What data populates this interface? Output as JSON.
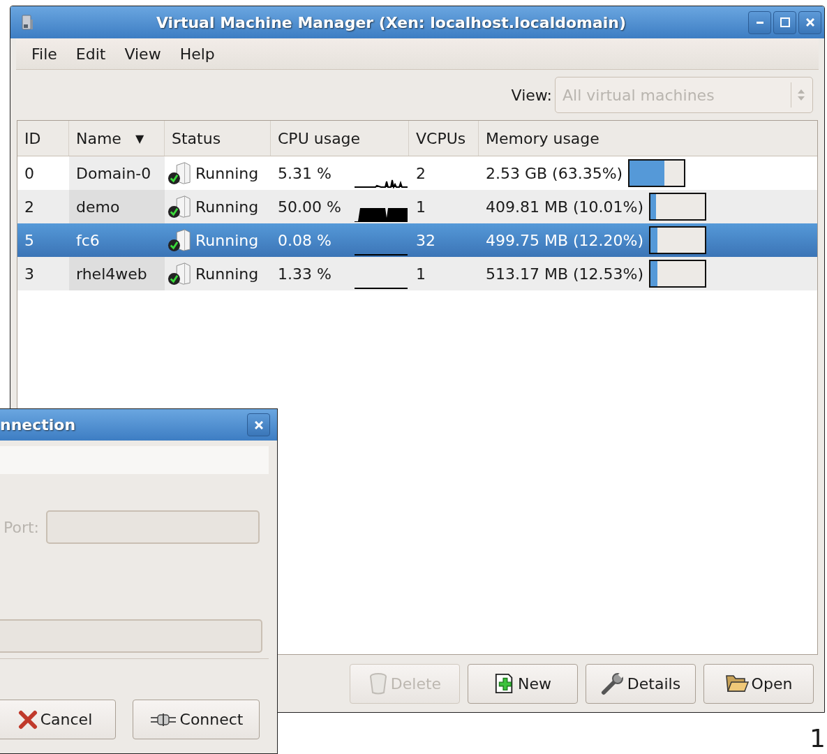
{
  "window": {
    "title": "Virtual Machine Manager (Xen: localhost.localdomain)"
  },
  "menu": [
    "File",
    "Edit",
    "View",
    "Help"
  ],
  "view_filter": {
    "label": "View:",
    "value": "All virtual machines",
    "disabled": true
  },
  "table": {
    "columns": [
      {
        "label": "ID"
      },
      {
        "label": "Name",
        "sort_arrow": "▼"
      },
      {
        "label": "Status"
      },
      {
        "label": "CPU usage"
      },
      {
        "label": "VCPUs"
      },
      {
        "label": "Memory usage"
      }
    ],
    "rows": [
      {
        "id": "0",
        "name": "Domain-0",
        "status": "Running",
        "cpu": "5.31 %",
        "vcpus": "2",
        "memory": "2.53 GB (63.35%)",
        "level": 0.6335,
        "selected": false
      },
      {
        "id": "2",
        "name": "demo",
        "status": "Running",
        "cpu": "50.00 %",
        "vcpus": "1",
        "memory": "409.81 MB (10.01%)",
        "level": 0.1001,
        "selected": false
      },
      {
        "id": "5",
        "name": "fc6",
        "status": "Running",
        "cpu": "0.08 %",
        "vcpus": "32",
        "memory": "499.75 MB (12.20%)",
        "level": 0.122,
        "selected": true
      },
      {
        "id": "3",
        "name": "rhel4web",
        "status": "Running",
        "cpu": "1.33 %",
        "vcpus": "1",
        "memory": "513.17 MB (12.53%)",
        "level": 0.1253,
        "selected": false
      }
    ]
  },
  "buttons": [
    {
      "label": "Delete",
      "kind": "trash",
      "disabled": true
    },
    {
      "label": "New",
      "kind": "new",
      "disabled": false
    },
    {
      "label": "Details",
      "kind": "wrench",
      "disabled": false
    },
    {
      "label": "Open",
      "kind": "folder",
      "disabled": false
    }
  ],
  "dialog": {
    "title": "nnection",
    "port_label": "Port:",
    "fields_disabled": true,
    "buttons": [
      {
        "label": "Cancel",
        "kind": "cancel"
      },
      {
        "label": "Connect",
        "kind": "plug"
      }
    ]
  },
  "stray_text": "1"
}
